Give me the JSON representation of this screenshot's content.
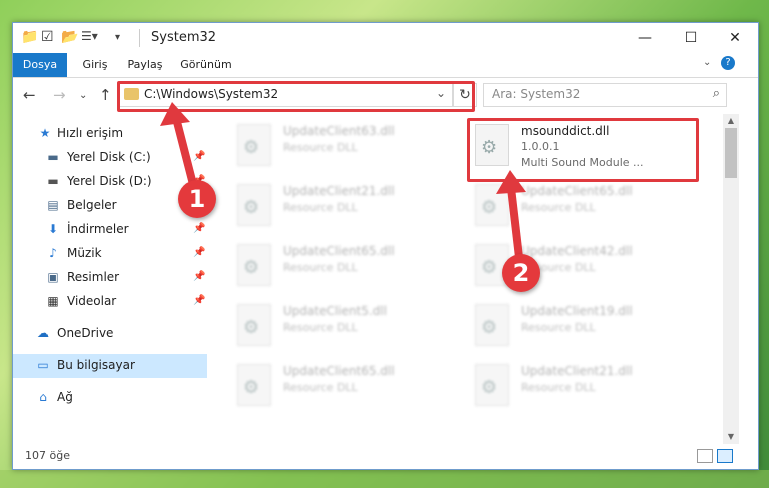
{
  "window": {
    "title": "System32"
  },
  "ribbon": {
    "tabs": [
      "Dosya",
      "Giriş",
      "Paylaş",
      "Görünüm"
    ]
  },
  "address": {
    "path": "C:\\Windows\\System32"
  },
  "search": {
    "placeholder": "Ara: System32"
  },
  "sidebar": {
    "items": [
      {
        "label": "Hızlı erişim",
        "icon": "star-icon",
        "pinned": false
      },
      {
        "label": "Yerel Disk (C:)",
        "icon": "drive-icon",
        "pinned": true
      },
      {
        "label": "Yerel Disk (D:)",
        "icon": "drive-icon",
        "pinned": true
      },
      {
        "label": "Belgeler",
        "icon": "documents-icon",
        "pinned": true
      },
      {
        "label": "İndirmeler",
        "icon": "download-icon",
        "pinned": true
      },
      {
        "label": "Müzik",
        "icon": "music-icon",
        "pinned": true
      },
      {
        "label": "Resimler",
        "icon": "pictures-icon",
        "pinned": true
      },
      {
        "label": "Videolar",
        "icon": "videos-icon",
        "pinned": true
      },
      {
        "label": "OneDrive",
        "icon": "cloud-icon",
        "pinned": false
      },
      {
        "label": "Bu bilgisayar",
        "icon": "computer-icon",
        "pinned": false
      },
      {
        "label": "Ağ",
        "icon": "network-icon",
        "pinned": false
      }
    ]
  },
  "files": {
    "left": [
      {
        "name": "UpdateClient63.dll",
        "type": "Resource DLL"
      },
      {
        "name": "UpdateClient21.dll",
        "type": "Resource DLL"
      },
      {
        "name": "UpdateClient65.dll",
        "type": "Resource DLL"
      },
      {
        "name": "UpdateClient5.dll",
        "type": "Resource DLL"
      },
      {
        "name": "UpdateClient65.dll",
        "type": "Resource DLL"
      }
    ],
    "right": [
      {
        "name": "msounddict.dll",
        "version": "1.0.0.1",
        "description": "Multi Sound Module ..."
      },
      {
        "name": "UpdateClient65.dll",
        "type": "Resource DLL"
      },
      {
        "name": "UpdateClient42.dll",
        "type": "Resource DLL"
      },
      {
        "name": "UpdateClient19.dll",
        "type": "Resource DLL"
      },
      {
        "name": "UpdateClient21.dll",
        "type": "Resource DLL"
      }
    ]
  },
  "status": {
    "count": "107 öğe"
  },
  "badges": {
    "first": "1",
    "second": "2"
  },
  "colors": {
    "accent": "#1979ca",
    "annotation": "#e0393e",
    "selection": "#cce8ff"
  }
}
